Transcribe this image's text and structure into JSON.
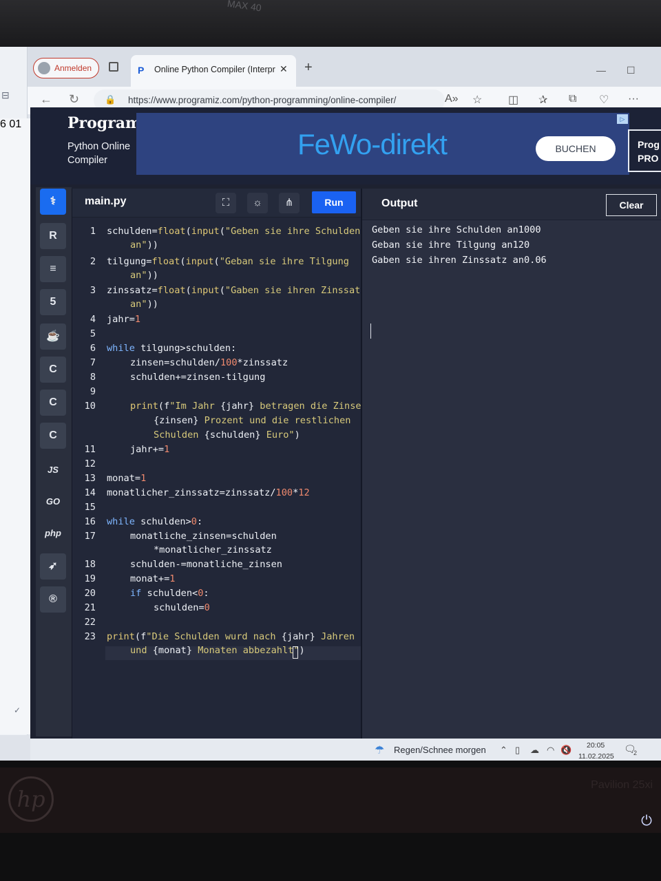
{
  "monitor": {
    "stand_label": "MAX 40",
    "model_label": "Pavilion 25xi",
    "brand_logo": "hp"
  },
  "sidebar": {
    "numbers": [
      "6",
      "01"
    ]
  },
  "browser": {
    "profile_label": "Anmelden",
    "tab_title": "Online Python Compiler (Interpreter)",
    "url": "https://www.programiz.com/python-programming/online-compiler/"
  },
  "site": {
    "logo": "Programiz",
    "subtitle_line1": "Python Online",
    "subtitle_line2": "Compiler",
    "ad": {
      "brand": "FeWo-direkt",
      "button": "BUCHEN"
    },
    "promo": {
      "line1": "Prog",
      "line2": "PRO"
    }
  },
  "rail": {
    "js": "JS",
    "go": "GO",
    "php": "php"
  },
  "editor": {
    "filename": "main.py",
    "run_label": "Run",
    "line_numbers": [
      "1",
      "2",
      "3",
      "4",
      "5",
      "6",
      "7",
      "8",
      "9",
      "10",
      "11",
      "12",
      "13",
      "14",
      "15",
      "16",
      "17",
      "18",
      "19",
      "20",
      "21",
      "22",
      "23"
    ]
  },
  "output": {
    "title": "Output",
    "clear_label": "Clear",
    "lines": [
      "Geben sie ihre Schulden an1000",
      "Geban sie ihre Tilgung an120",
      "Gaben sie ihren Zinssatz an0.06"
    ]
  },
  "taskbar": {
    "weather": "Regen/Schnee morgen",
    "time": "20:05",
    "date": "11.02.2025",
    "notifications": "2"
  },
  "colors": {
    "accent": "#1a62f2",
    "editor_bg": "#222738",
    "output_bg": "#2a2f40"
  }
}
